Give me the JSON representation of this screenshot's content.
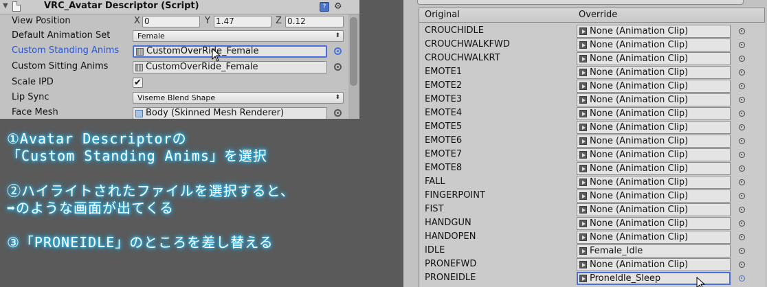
{
  "inspector": {
    "title": "VRC_Avatar Descriptor (Script)",
    "view_position": {
      "label": "View Position",
      "x_label": "X",
      "x": "0",
      "y_label": "Y",
      "y": "1.47",
      "z_label": "Z",
      "z": "0.12"
    },
    "default_animation_set": {
      "label": "Default Animation Set",
      "value": "Female"
    },
    "custom_standing_anims": {
      "label": "Custom Standing Anims",
      "value": "CustomOverRide_Female"
    },
    "custom_sitting_anims": {
      "label": "Custom Sitting Anims",
      "value": "CustomOverRide_Female"
    },
    "scale_ipd": {
      "label": "Scale IPD",
      "checked": "✔"
    },
    "lip_sync": {
      "label": "Lip Sync",
      "value": "Viseme Blend Shape"
    },
    "face_mesh": {
      "label": "Face Mesh",
      "value": "Body (Skinned Mesh Renderer)"
    }
  },
  "instructions": {
    "line1": "①Avatar Descriptorの",
    "line2": "「Custom Standing Anims」を選択",
    "line3": "②ハイライトされたファイルを選択すると、",
    "line4": "➡のような画面が出てくる",
    "line5": "③「PRONEIDLE」のところを差し替える"
  },
  "overrides": {
    "col_original": "Original",
    "col_override": "Override",
    "rows": [
      {
        "name": "CROUCHIDLE",
        "value": "None (Animation Clip)"
      },
      {
        "name": "CROUCHWALKFWD",
        "value": "None (Animation Clip)"
      },
      {
        "name": "CROUCHWALKRT",
        "value": "None (Animation Clip)"
      },
      {
        "name": "EMOTE1",
        "value": "None (Animation Clip)"
      },
      {
        "name": "EMOTE2",
        "value": "None (Animation Clip)"
      },
      {
        "name": "EMOTE3",
        "value": "None (Animation Clip)"
      },
      {
        "name": "EMOTE4",
        "value": "None (Animation Clip)"
      },
      {
        "name": "EMOTE5",
        "value": "None (Animation Clip)"
      },
      {
        "name": "EMOTE6",
        "value": "None (Animation Clip)"
      },
      {
        "name": "EMOTE7",
        "value": "None (Animation Clip)"
      },
      {
        "name": "EMOTE8",
        "value": "None (Animation Clip)"
      },
      {
        "name": "FALL",
        "value": "None (Animation Clip)"
      },
      {
        "name": "FINGERPOINT",
        "value": "None (Animation Clip)"
      },
      {
        "name": "FIST",
        "value": "None (Animation Clip)"
      },
      {
        "name": "HANDGUN",
        "value": "None (Animation Clip)"
      },
      {
        "name": "HANDOPEN",
        "value": "None (Animation Clip)"
      },
      {
        "name": "IDLE",
        "value": "Female_Idle"
      },
      {
        "name": "PRONEFWD",
        "value": "None (Animation Clip)"
      },
      {
        "name": "PRONEIDLE",
        "value": "ProneIdle_Sleep"
      }
    ]
  },
  "colors": {
    "panel": "#c2c2c2",
    "background": "#5a5a5a",
    "highlight": "#4a6fd6",
    "glow": "#28c8ff"
  }
}
